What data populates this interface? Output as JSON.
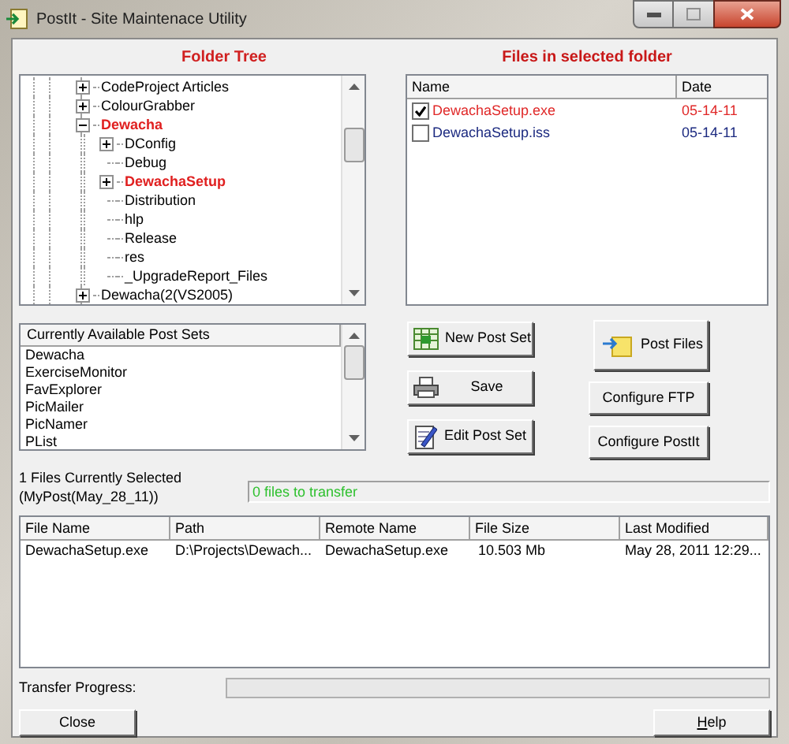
{
  "window": {
    "title": "PostIt - Site Maintenace Utility"
  },
  "folder_tree": {
    "title": "Folder Tree",
    "nodes": [
      {
        "label": "CodeProject Articles",
        "expandable": true,
        "expanded": false,
        "highlighted": false
      },
      {
        "label": "ColourGrabber",
        "expandable": true,
        "expanded": false,
        "highlighted": false
      },
      {
        "label": "Dewacha",
        "expandable": true,
        "expanded": true,
        "highlighted": true,
        "children": [
          {
            "label": "DConfig",
            "expandable": true,
            "expanded": false,
            "highlighted": false
          },
          {
            "label": "Debug",
            "expandable": false,
            "highlighted": false
          },
          {
            "label": "DewachaSetup",
            "expandable": true,
            "expanded": false,
            "highlighted": true
          },
          {
            "label": "Distribution",
            "expandable": false,
            "highlighted": false
          },
          {
            "label": "hlp",
            "expandable": false,
            "highlighted": false
          },
          {
            "label": "Release",
            "expandable": false,
            "highlighted": false
          },
          {
            "label": "res",
            "expandable": false,
            "highlighted": false
          },
          {
            "label": "_UpgradeReport_Files",
            "expandable": false,
            "highlighted": false
          }
        ]
      },
      {
        "label": "Dewacha(2(VS2005)",
        "expandable": true,
        "expanded": false,
        "highlighted": false
      }
    ]
  },
  "files_panel": {
    "title": "Files in selected folder",
    "columns": [
      "Name",
      "Date"
    ],
    "files": [
      {
        "name": "DewachaSetup.exe",
        "date": "05-14-11",
        "checked": true,
        "color": "#e02828"
      },
      {
        "name": "DewachaSetup.iss",
        "date": "05-14-11",
        "checked": false,
        "color": "#1c2a80"
      }
    ]
  },
  "post_sets": {
    "header": "Currently Available Post Sets",
    "items": [
      "Dewacha",
      "ExerciseMonitor",
      "FavExplorer",
      "PicMailer",
      "PicNamer",
      "PList"
    ]
  },
  "set_buttons": [
    {
      "label": "New Post Set",
      "kind": "new"
    },
    {
      "label": "Save",
      "kind": "save"
    },
    {
      "label": "Edit Post Set",
      "kind": "edit"
    }
  ],
  "action_buttons": [
    {
      "label": "Post Files",
      "kind": "post"
    },
    {
      "label": "Configure FTP",
      "kind": "plain"
    },
    {
      "label": "Configure PostIt",
      "kind": "plain"
    }
  ],
  "selection_info": [
    "1 Files Currently Selected",
    "(MyPost(May_28_11))"
  ],
  "transfer_status": "0 files to transfer",
  "transfer_table": {
    "columns": [
      "File Name",
      "Path",
      "Remote Name",
      "File Size",
      "Last Modified"
    ],
    "rows": [
      [
        "DewachaSetup.exe",
        "D:\\Projects\\Dewach...",
        "DewachaSetup.exe",
        "10.503 Mb",
        "May 28, 2011 12:29..."
      ]
    ]
  },
  "progress": {
    "label": "Transfer Progress:",
    "level": 0
  },
  "footer_buttons": [
    {
      "label": "Close",
      "mnemonic_first": false
    },
    {
      "label": "Help",
      "mnemonic_first": true
    }
  ]
}
